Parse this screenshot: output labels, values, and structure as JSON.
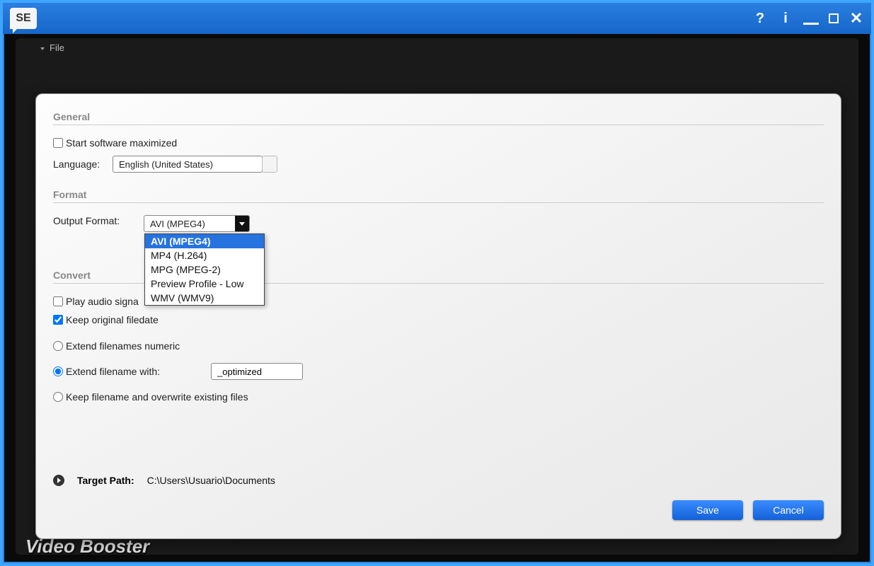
{
  "chrome": {
    "logo_text": "SE",
    "help_glyph": "?",
    "info_glyph": "i",
    "close_glyph": "✕"
  },
  "back": {
    "file_menu": "File",
    "footer_text": "Video Booster"
  },
  "sections": {
    "general": "General",
    "format": "Format",
    "convert": "Convert"
  },
  "general": {
    "start_maximized_label": "Start software maximized",
    "language_label": "Language:",
    "language_value": "English (United States)"
  },
  "format": {
    "output_label": "Output Format:",
    "selected": "AVI (MPEG4)",
    "options": [
      "AVI (MPEG4)",
      "MP4 (H.264)",
      "MPG (MPEG-2)",
      "Preview Profile - Low",
      "WMV (WMV9)"
    ]
  },
  "convert": {
    "play_audio_label": "Play audio signa",
    "keep_date_label": "Keep original filedate",
    "extend_numeric_label": "Extend filenames numeric",
    "extend_with_label": "Extend filename with:",
    "extend_with_value": "_optimized",
    "keep_overwrite_label": "Keep filename and overwrite existing files"
  },
  "target": {
    "label": "Target Path:",
    "path": "C:\\Users\\Usuario\\Documents"
  },
  "buttons": {
    "save": "Save",
    "cancel": "Cancel"
  }
}
